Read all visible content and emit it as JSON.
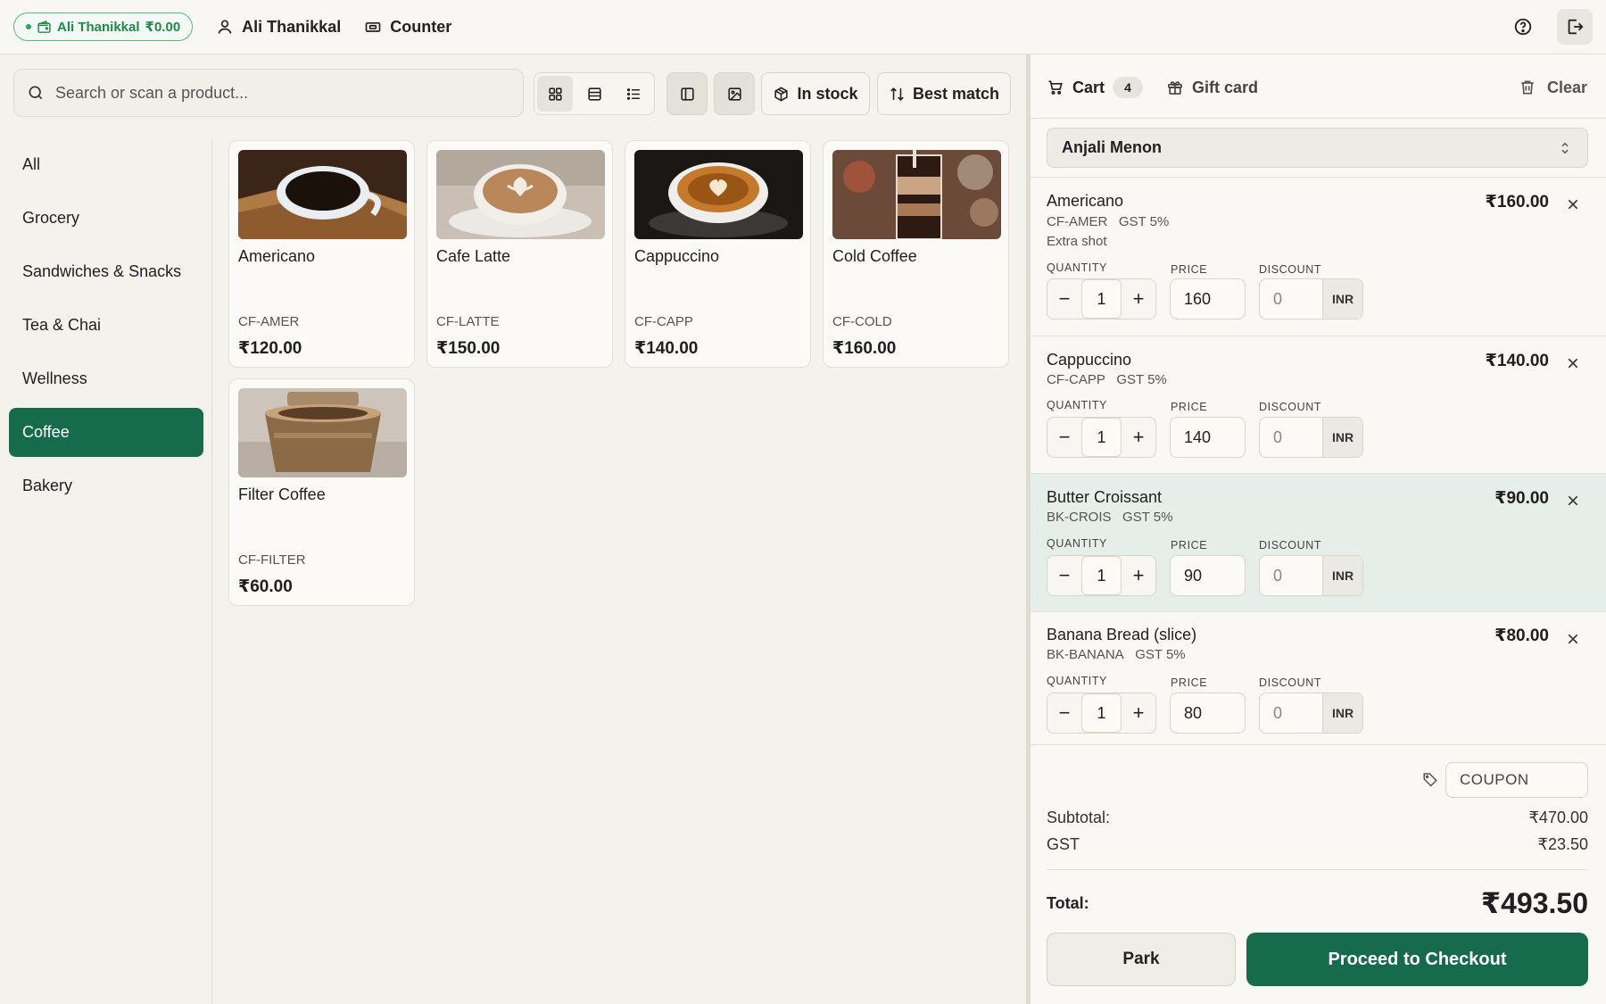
{
  "header": {
    "wallet_label": "Ali Thanikkal",
    "wallet_amount": "₹0.00",
    "user_name": "Ali Thanikkal",
    "register_name": "Counter"
  },
  "toolbar": {
    "search_placeholder": "Search or scan a product...",
    "stock_filter_label": "In stock",
    "sort_label": "Best match"
  },
  "categories": [
    "All",
    "Grocery",
    "Sandwiches & Snacks",
    "Tea & Chai",
    "Wellness",
    "Coffee",
    "Bakery"
  ],
  "active_category": "Coffee",
  "products": [
    {
      "name": "Americano",
      "sku": "CF-AMER",
      "price": "₹120.00"
    },
    {
      "name": "Cafe Latte",
      "sku": "CF-LATTE",
      "price": "₹150.00"
    },
    {
      "name": "Cappuccino",
      "sku": "CF-CAPP",
      "price": "₹140.00"
    },
    {
      "name": "Cold Coffee",
      "sku": "CF-COLD",
      "price": "₹160.00"
    },
    {
      "name": "Filter Coffee",
      "sku": "CF-FILTER",
      "price": "₹60.00"
    }
  ],
  "cart": {
    "tab_label": "Cart",
    "count": "4",
    "gift_card_label": "Gift card",
    "clear_label": "Clear",
    "customer": "Anjali Menon",
    "labels": {
      "quantity": "QUANTITY",
      "price": "PRICE",
      "discount": "DISCOUNT"
    },
    "items": [
      {
        "name": "Americano",
        "sku": "CF-AMER",
        "tax": "GST 5%",
        "modifier": "Extra shot",
        "total": "₹160.00",
        "qty": "1",
        "price": "160",
        "discount": "0",
        "currency": "INR"
      },
      {
        "name": "Cappuccino",
        "sku": "CF-CAPP",
        "tax": "GST 5%",
        "total": "₹140.00",
        "qty": "1",
        "price": "140",
        "discount": "0",
        "currency": "INR"
      },
      {
        "name": "Butter Croissant",
        "sku": "BK-CROIS",
        "tax": "GST 5%",
        "total": "₹90.00",
        "qty": "1",
        "price": "90",
        "discount": "0",
        "currency": "INR"
      },
      {
        "name": "Banana Bread (slice)",
        "sku": "BK-BANANA",
        "tax": "GST 5%",
        "total": "₹80.00",
        "qty": "1",
        "price": "80",
        "discount": "0",
        "currency": "INR"
      }
    ],
    "coupon_placeholder": "COUPON",
    "subtotal_label": "Subtotal:",
    "subtotal": "₹470.00",
    "gst_label": "GST",
    "gst": "₹23.50",
    "total_label": "Total:",
    "total": "₹493.50",
    "park_label": "Park",
    "checkout_label": "Proceed to Checkout"
  },
  "colors": {
    "accent": "#176b4d",
    "wallet": "#1e8a47",
    "highlight_row": "#e5eee8"
  }
}
